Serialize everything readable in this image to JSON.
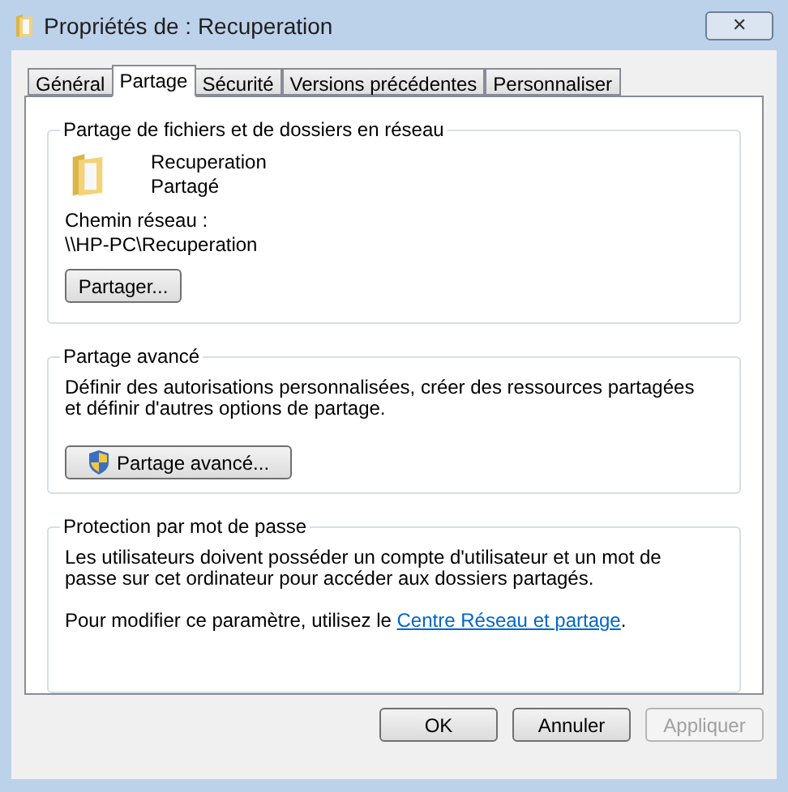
{
  "window": {
    "title": "Propriétés de : Recuperation",
    "close": "✕"
  },
  "tabs": [
    {
      "label": "Général",
      "selected": false
    },
    {
      "label": "Partage",
      "selected": true
    },
    {
      "label": "Sécurité",
      "selected": false
    },
    {
      "label": "Versions précédentes",
      "selected": false
    },
    {
      "label": "Personnaliser",
      "selected": false
    }
  ],
  "network_sharing": {
    "title": "Partage de fichiers et de dossiers en réseau",
    "folder_name": "Recuperation",
    "folder_status": "Partagé",
    "path_label": "Chemin réseau :",
    "path": "\\\\HP-PC\\Recuperation",
    "button": "Partager..."
  },
  "advanced_sharing": {
    "title": "Partage avancé",
    "description": "Définir des autorisations personnalisées, créer des ressources partagées et définir d'autres options de partage.",
    "button": "Partage avancé..."
  },
  "password_protection": {
    "title": "Protection par mot de passe",
    "description": "Les utilisateurs doivent posséder un compte d'utilisateur et un mot de passe sur cet ordinateur pour accéder aux dossiers partagés.",
    "setting_text": "Pour modifier ce paramètre, utilisez le",
    "link": "Centre Réseau et partage",
    "setting_end": "."
  },
  "buttons": [
    {
      "label": "OK",
      "disabled": false
    },
    {
      "label": "Annuler",
      "disabled": false
    },
    {
      "label": "Appliquer",
      "disabled": true
    }
  ]
}
